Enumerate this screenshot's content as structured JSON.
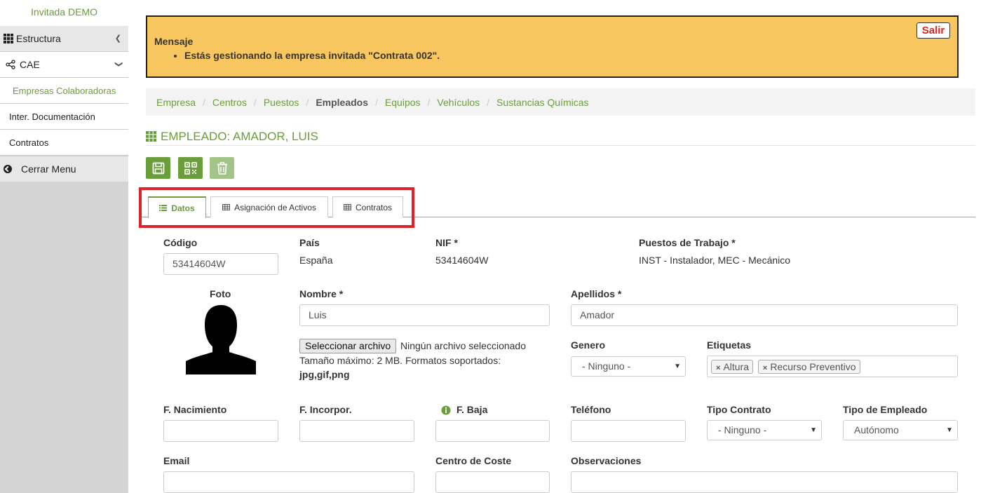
{
  "sidebar": {
    "user": "Invitada DEMO",
    "items": [
      {
        "label": "Estructura",
        "icon": "grid-icon"
      },
      {
        "label": "CAE",
        "icon": "share-icon"
      }
    ],
    "sub": [
      "Empresas Colaboradoras",
      "Inter. Documentación",
      "Contratos"
    ],
    "close_label": "Cerrar Menu"
  },
  "message": {
    "title": "Mensaje",
    "text": "Estás gestionando la empresa invitada \"Contrata 002\".",
    "exit_label": "Salir"
  },
  "breadcrumb": [
    "Empresa",
    "Centros",
    "Puestos",
    "Empleados",
    "Equipos",
    "Vehículos",
    "Sustancias Químicas"
  ],
  "page_title": "EMPLEADO: AMADOR, LUIS",
  "tabs": [
    "Datos",
    "Asignación de Activos",
    "Contratos"
  ],
  "form": {
    "codigo": {
      "label": "Código",
      "value": "53414604W"
    },
    "pais": {
      "label": "País",
      "value": "España"
    },
    "nif": {
      "label": "NIF *",
      "value": "53414604W"
    },
    "puestos": {
      "label": "Puestos de Trabajo *",
      "value": "INST - Instalador, MEC - Mecánico"
    },
    "foto_label": "Foto",
    "nombre": {
      "label": "Nombre *",
      "value": "Luis"
    },
    "apellidos": {
      "label": "Apellidos *",
      "value": "Amador"
    },
    "file": {
      "button": "Seleccionar archivo",
      "status": "Ningún archivo seleccionado",
      "hint": "Tamaño máximo: 2 MB. Formatos soportados:",
      "formats": "jpg,gif,png"
    },
    "genero": {
      "label": "Genero",
      "value": "- Ninguno -"
    },
    "etiquetas": {
      "label": "Etiquetas",
      "tags": [
        "Altura",
        "Recurso Preventivo"
      ]
    },
    "f_nacimiento": {
      "label": "F. Nacimiento",
      "value": ""
    },
    "f_incorpor": {
      "label": "F. Incorpor.",
      "value": ""
    },
    "f_baja": {
      "label": "F. Baja",
      "value": ""
    },
    "telefono": {
      "label": "Teléfono",
      "value": ""
    },
    "tipo_contrato": {
      "label": "Tipo Contrato",
      "value": "- Ninguno -"
    },
    "tipo_empleado": {
      "label": "Tipo de Empleado",
      "value": "Autónomo"
    },
    "email": {
      "label": "Email",
      "value": ""
    },
    "centro_coste": {
      "label": "Centro de Coste",
      "value": ""
    },
    "observaciones": {
      "label": "Observaciones",
      "value": ""
    }
  },
  "colors": {
    "accent": "#6a9e3a",
    "message_bg": "#f8c65f",
    "highlight": "#e0232b"
  }
}
